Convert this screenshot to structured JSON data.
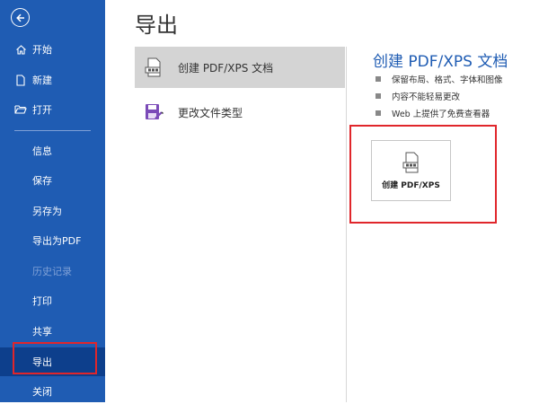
{
  "sidebar": {
    "items": [
      {
        "label": "开始"
      },
      {
        "label": "新建"
      },
      {
        "label": "打开"
      },
      {
        "label": "信息"
      },
      {
        "label": "保存"
      },
      {
        "label": "另存为"
      },
      {
        "label": "导出为PDF"
      },
      {
        "label": "历史记录"
      },
      {
        "label": "打印"
      },
      {
        "label": "共享"
      },
      {
        "label": "导出"
      },
      {
        "label": "关闭"
      }
    ]
  },
  "page": {
    "title": "导出"
  },
  "options": [
    {
      "label": "创建 PDF/XPS 文档"
    },
    {
      "label": "更改文件类型"
    }
  ],
  "detail": {
    "title": "创建 PDF/XPS 文档",
    "bullets": [
      "保留布局、格式、字体和图像",
      "内容不能轻易更改",
      "Web 上提供了免费查看器"
    ],
    "button_label": "创建 PDF/XPS"
  },
  "colors": {
    "sidebar": "#1f5cb3",
    "sidebar_active": "#0d3f8c",
    "highlight": "#e0262b",
    "accent_text": "#1f5cb3"
  }
}
